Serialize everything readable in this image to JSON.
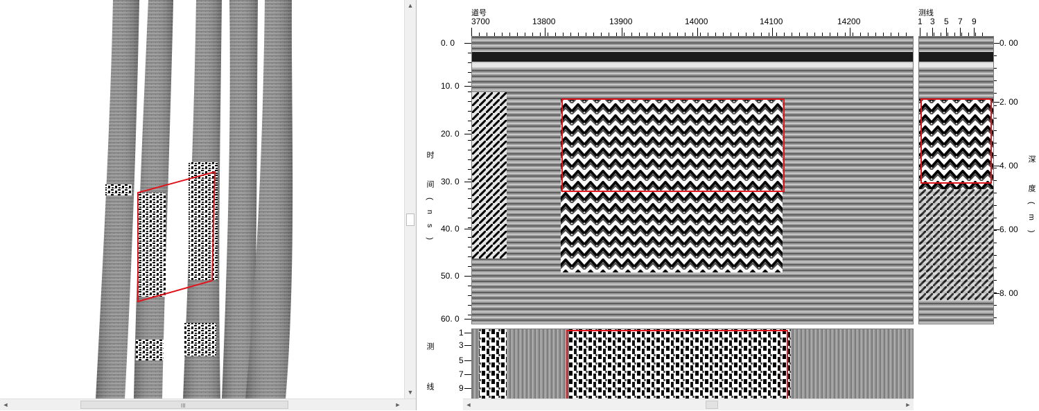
{
  "window": {
    "title": ""
  },
  "top_axis": {
    "title": "道号",
    "ticks": [
      "3700",
      "13800",
      "13900",
      "14000",
      "14100",
      "14200"
    ]
  },
  "left_axis": {
    "title": "时 间(ns)",
    "ticks": [
      "0. 0",
      "10. 0",
      "20. 0",
      "30. 0",
      "40. 0",
      "50. 0",
      "60. 0"
    ]
  },
  "right_top_axis": {
    "title": "测线",
    "ticks": [
      "1",
      "3",
      "5",
      "7",
      "9"
    ]
  },
  "right_axis": {
    "title": "深 度(m)",
    "ticks": [
      "0. 00",
      "2. 00",
      "4. 00",
      "6. 00",
      "8. 00"
    ]
  },
  "bottom_left_axis": {
    "title": "测 线",
    "ticks": [
      "1",
      "3",
      "5",
      "7",
      "9"
    ]
  },
  "scrollbars": {
    "left_h_grip": "III",
    "arrows": {
      "left": "◄",
      "right": "►",
      "up": "▲",
      "down": "▼"
    }
  },
  "colors": {
    "highlight": "#e0141b",
    "panel_border": "#7a7a7a"
  }
}
